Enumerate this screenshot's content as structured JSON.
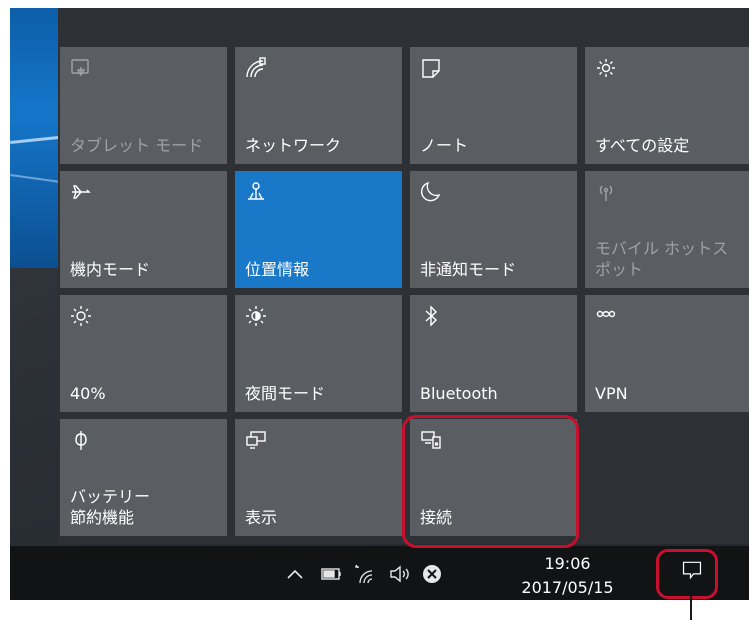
{
  "tiles": [
    {
      "label": "タブレット モード",
      "icon": "tablet-mode-icon",
      "state": "dim"
    },
    {
      "label": "ネットワーク",
      "icon": "network-icon",
      "state": "off"
    },
    {
      "label": "ノート",
      "icon": "note-icon",
      "state": "off"
    },
    {
      "label": "すべての設定",
      "icon": "gear-icon",
      "state": "off"
    },
    {
      "label": "機内モード",
      "icon": "airplane-icon",
      "state": "off"
    },
    {
      "label": "位置情報",
      "icon": "location-icon",
      "state": "on"
    },
    {
      "label": "非通知モード",
      "icon": "moon-icon",
      "state": "off"
    },
    {
      "label": "モバイル ホットス\nポット",
      "icon": "hotspot-icon",
      "state": "dim"
    },
    {
      "label": "40%",
      "icon": "brightness-icon",
      "state": "off"
    },
    {
      "label": "夜間モード",
      "icon": "night-light-icon",
      "state": "off"
    },
    {
      "label": "Bluetooth",
      "icon": "bluetooth-icon",
      "state": "off"
    },
    {
      "label": "VPN",
      "icon": "vpn-icon",
      "state": "off"
    },
    {
      "label": "バッテリー\n節約機能",
      "icon": "battery-saver-icon",
      "state": "off"
    },
    {
      "label": "表示",
      "icon": "display-icon",
      "state": "off"
    },
    {
      "label": "接続",
      "icon": "connect-icon",
      "state": "off",
      "highlighted": true
    }
  ],
  "taskbar": {
    "clock_time": "19:06",
    "clock_date": "2017/05/15",
    "tray_icons": [
      "chevron-up-icon",
      "battery-icon",
      "wifi-icon",
      "volume-icon",
      "close-circle-icon"
    ],
    "notification_icon": "action-center-icon"
  },
  "colors": {
    "tile": "#5a5e62",
    "tile_active": "#1a78c8",
    "panel": "#2d3135",
    "taskbar": "#111315",
    "highlight": "#c8102e"
  }
}
